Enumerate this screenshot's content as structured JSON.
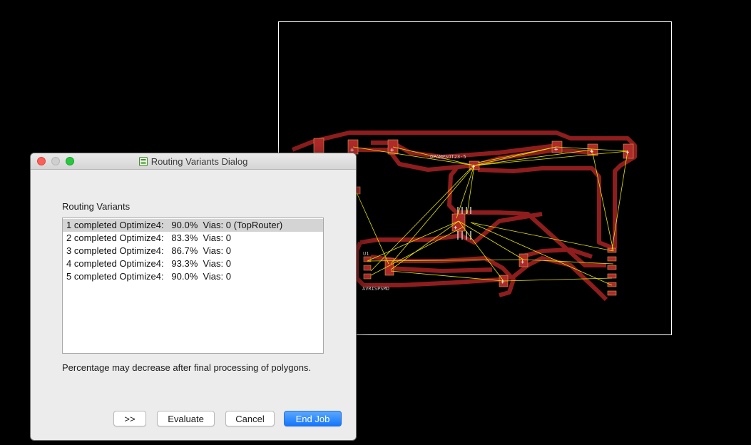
{
  "board": {
    "labels": {
      "opamp": "OPAMPSOT23-5",
      "u1": "U1",
      "avr": "AVRISPSMD"
    },
    "colors": {
      "background": "#000000",
      "outline": "#ffffff",
      "trace": "#8f1d1d",
      "pad": "#b02a2a",
      "airwire": "#e6e600"
    }
  },
  "dialog": {
    "title": "Routing Variants Dialog",
    "section_label": "Routing Variants",
    "variants": [
      "1 completed Optimize4:   90.0%  Vias: 0 (TopRouter)",
      "2 completed Optimize4:   83.3%  Vias: 0",
      "3 completed Optimize4:   86.7%  Vias: 0",
      "4 completed Optimize4:   93.3%  Vias: 0",
      "5 completed Optimize4:   90.0%  Vias: 0"
    ],
    "selected_index": 0,
    "note": "Percentage may decrease after final processing of polygons.",
    "buttons": {
      "more": ">>",
      "evaluate": "Evaluate",
      "cancel": "Cancel",
      "end_job": "End Job"
    },
    "accent_color": "#1476fb"
  }
}
